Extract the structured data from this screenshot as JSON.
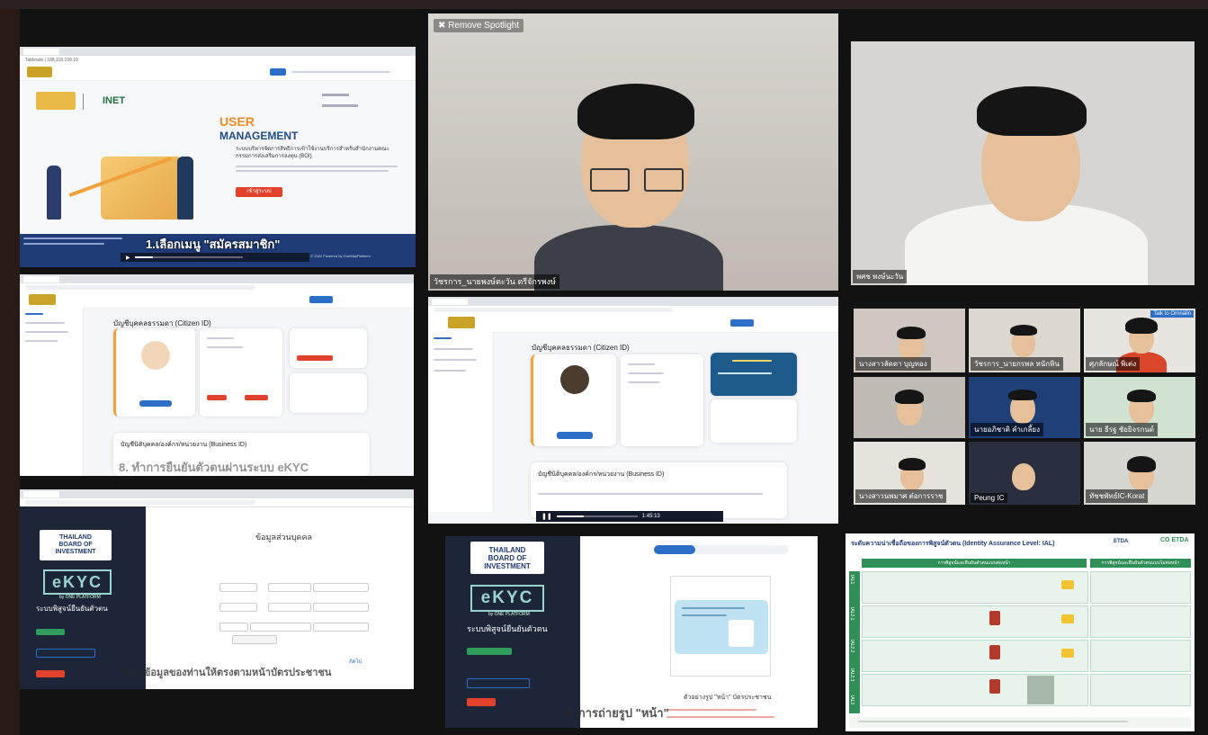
{
  "tile_a": {
    "url": "Tableado | 188.118.199.19",
    "header_brand": "INET",
    "hero_title_line1": "USER",
    "hero_title_line2": "MANAGEMENT",
    "hero_desc": "ระบบบริหารจัดการสิทธิการเข้าใช้งานบริการสำหรับสำนักงานคณะกรรมการส่งเสริมการลงทุน (BOI)",
    "cta_label": "เข้าสู่ระบบ",
    "overlay_step": "1.เลือกเมนู \"สมัครสมาชิก\"",
    "footer_note": "Copyright © 2022 Powered by OneWayPlatform"
  },
  "tile_b": {
    "name_tag": "วัชรการ_นายพงษ์ตะวัน ตรีจักรพงษ์",
    "control": "Remove Spotlight"
  },
  "tile_c": {
    "name_tag": "พศช พงษ์นะวัน"
  },
  "tile_d": {
    "section_title": "บัญชีบุคคลธรรมดา (Citizen ID)",
    "section2_title": "บัญชีนิติบุคคล/องค์กร/หน่วยงาน (Business ID)",
    "overlay_step": "8. ทำการยืนยันตัวตนผ่านระบบ eKYC"
  },
  "tile_e": {
    "section_title": "บัญชีบุคคลธรรมดา (Citizen ID)",
    "section2_title": "บัญชีนิติบุคคล/องค์กร/หน่วยงาน (Business ID)",
    "time": "1:45:13"
  },
  "tile_f": {
    "brand_line1": "THAILAND",
    "brand_line2": "BOARD OF",
    "brand_line3": "INVESTMENT",
    "ekyc": "eKYC",
    "platform": "by ONE PLATFORM",
    "subtitle": "ระบบพิสูจน์ยืนยันตัวตน",
    "form_title": "ข้อมูลส่วนบุคคล",
    "next": "ถัดไป",
    "overlay_caption": "กรอกข้อมูลของท่านให้ตรงตามหน้าบัตรประชาชน"
  },
  "tile_g": {
    "brand_line1": "THAILAND",
    "brand_line2": "BOARD OF",
    "brand_line3": "INVESTMENT",
    "ekyc": "eKYC",
    "platform": "by ONE PLATFORM",
    "subtitle": "ระบบพิสูจน์ยืนยันตัวตน",
    "card_caption": "ตัวอย่างรูป \"หน้า\" บัตรประชาชน",
    "overlay_caption": "ทำการถ่ายรูป \"หน้า\""
  },
  "participants": [
    {
      "name": "นางสาวลัดดา บุญทอง"
    },
    {
      "name": "วัชรการ_นายกรพล หนักหิน"
    },
    {
      "name": "ศุภลักษณ์ พิเต่ง"
    },
    {
      "name": "",
      "tag": ""
    },
    {
      "name": "นายอภิชาติ คำเกลี้ยง"
    },
    {
      "name": "นาย ธีรฐ ชัยยิจรกนต์"
    },
    {
      "name": "นางสาวนพมาศ ต๋อการราช"
    },
    {
      "name": "Peung IC"
    },
    {
      "name": "ทัชชพัทธ์IC-Korat"
    }
  ],
  "talk_button": "Talk to Ornnalin",
  "tile_h": {
    "title": "ระดับความน่าเชื่อถือของการพิสูจน์ตัวตน (Identity Assurance Level: IAL)",
    "logo1": "ETDA",
    "logo2": "CO ETDA",
    "levels": [
      "IAL1",
      "IAL2.1",
      "IAL2.2",
      "IAL2.3",
      "IAL3"
    ],
    "col1": "การพิสูจน์และยืนยันตัวตนแบบต่อหน้า",
    "col2": "การพิสูจน์และยืนยันตัวตนแบบไม่ต่อหน้า"
  },
  "colors": {
    "accent_orange": "#f28a1e",
    "brand_blue": "#1f4a8a",
    "ekyc_teal": "#9ad4cf",
    "ekyc_bg": "#1d2638",
    "red_button": "#e2412c",
    "ial_green": "#2f8f57"
  }
}
